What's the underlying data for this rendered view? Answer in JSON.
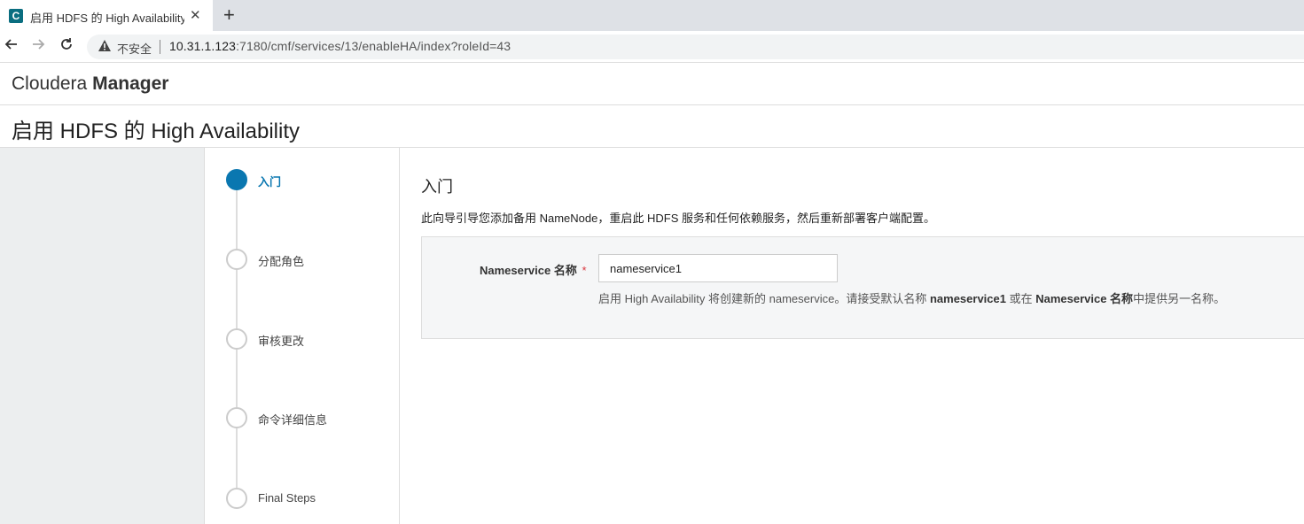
{
  "browser": {
    "tab_title": "启用 HDFS 的 High Availability",
    "tab_favicon_letter": "C",
    "new_tab_symbol": "+",
    "close_symbol": "✕",
    "insecure_label": "不安全",
    "url_host": "10.31.1.123",
    "url_path": ":7180/cmf/services/13/enableHA/index?roleId=43"
  },
  "app": {
    "brand_light": "Cloudera",
    "brand_bold": "Manager",
    "page_title": "启用 HDFS 的 High Availability"
  },
  "steps": [
    {
      "label": "入门",
      "active": true
    },
    {
      "label": "分配角色",
      "active": false
    },
    {
      "label": "审核更改",
      "active": false
    },
    {
      "label": "命令详细信息",
      "active": false
    },
    {
      "label": "Final Steps",
      "active": false
    }
  ],
  "main": {
    "section_title": "入门",
    "intro_text": "此向导引导您添加备用 NameNode，重启此 HDFS 服务和任何依赖服务，然后重新部署客户端配置。",
    "field_label": "Nameservice 名称",
    "required_mark": "*",
    "field_value": "nameservice1",
    "help_prefix": "启用 High Availability 将创建新的 nameservice。请接受默认名称 ",
    "help_bold1": "nameservice1",
    "help_middle": " 或在 ",
    "help_bold2": "Nameservice 名称",
    "help_suffix": "中提供另一名称。"
  },
  "colors": {
    "accent": "#0a77b0",
    "required": "#d9363e",
    "favicon": "#0a6e80"
  },
  "icons": {
    "back": "arrow-left-icon",
    "forward": "arrow-right-icon",
    "reload": "reload-icon",
    "warning": "warning-triangle-icon"
  }
}
